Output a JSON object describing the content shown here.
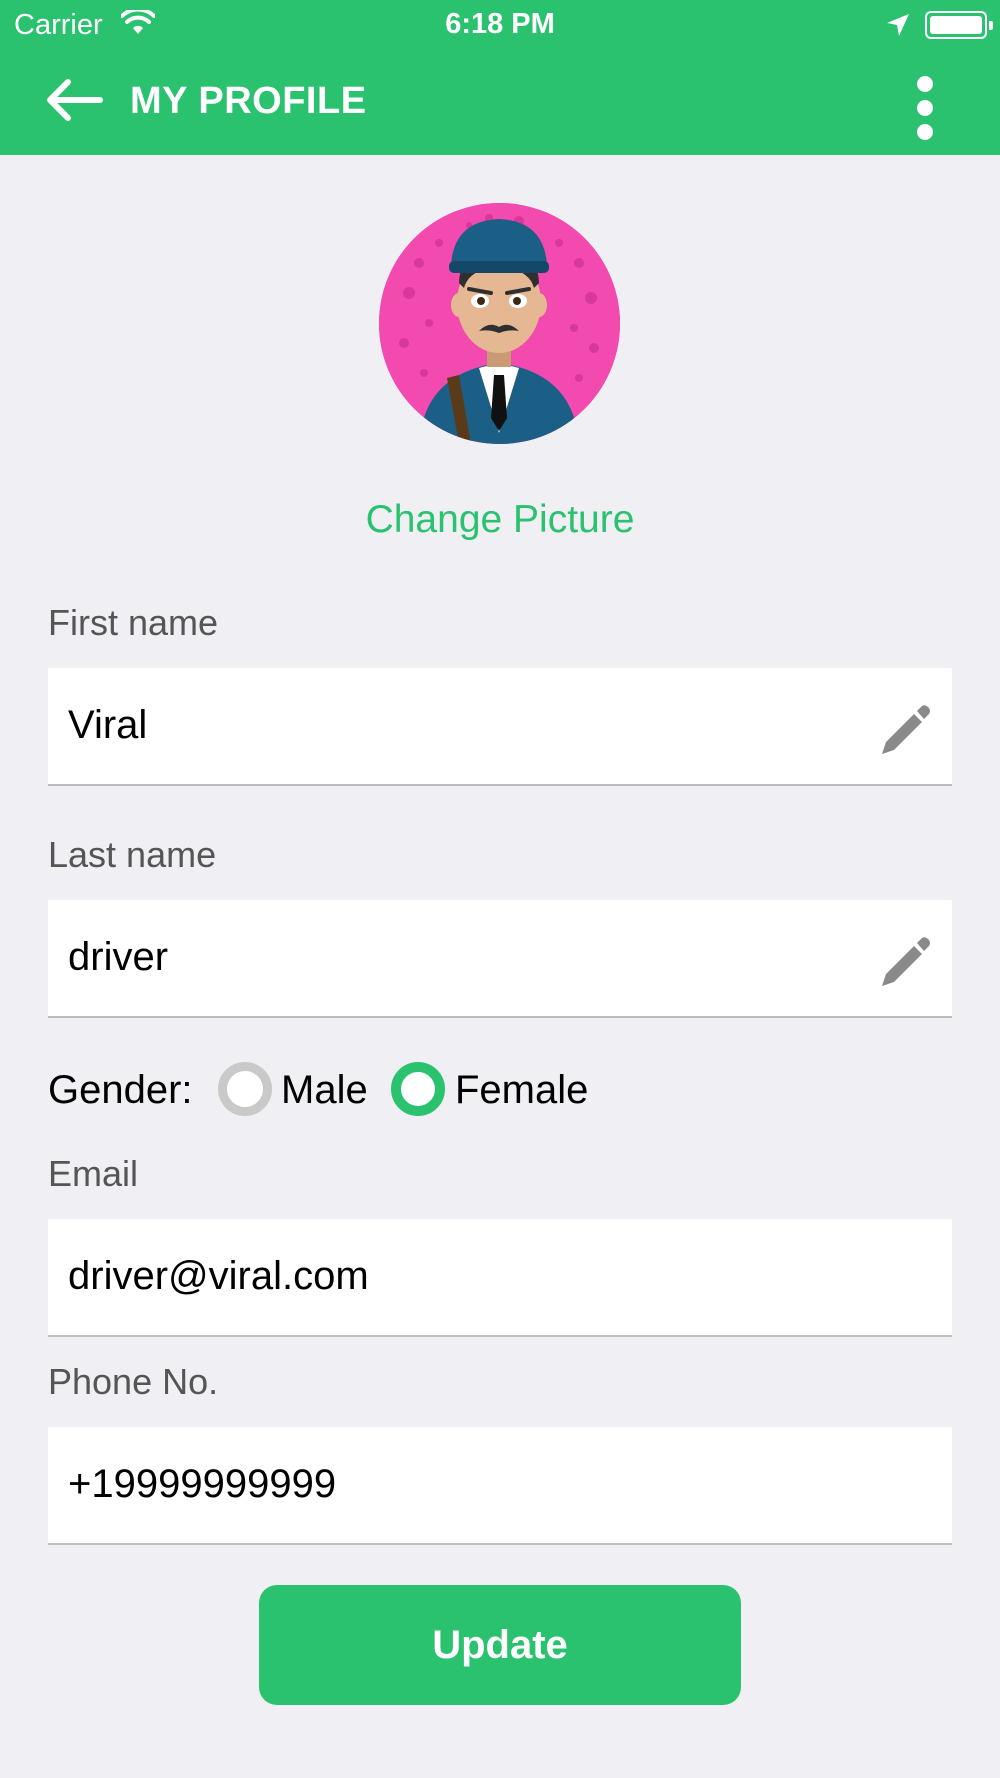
{
  "status_bar": {
    "carrier": "Carrier",
    "time": "6:18 PM",
    "wifi_icon": "wifi-icon",
    "location_icon": "location-arrow-icon",
    "battery_icon": "battery-full-icon"
  },
  "header": {
    "title": "MY PROFILE",
    "back_icon": "arrow-left-icon",
    "more_icon": "more-vertical-icon",
    "background_color": "#2bc26f"
  },
  "profile": {
    "avatar_icon": "driver-avatar",
    "avatar_background": "#f24aaf",
    "change_picture": "Change Picture"
  },
  "form": {
    "first_name": {
      "label": "First name",
      "value": "Viral",
      "edit_icon": "pencil-icon"
    },
    "last_name": {
      "label": "Last name",
      "value": "driver",
      "edit_icon": "pencil-icon"
    },
    "gender": {
      "label": "Gender:",
      "options": [
        {
          "label": "Male",
          "selected": false
        },
        {
          "label": "Female",
          "selected": true
        }
      ]
    },
    "email": {
      "label": "Email",
      "value": "driver@viral.com"
    },
    "phone": {
      "label": "Phone No.",
      "value": "+19999999999"
    }
  },
  "actions": {
    "update": "Update"
  },
  "colors": {
    "accent": "#2bc26f",
    "background": "#efeff4"
  }
}
